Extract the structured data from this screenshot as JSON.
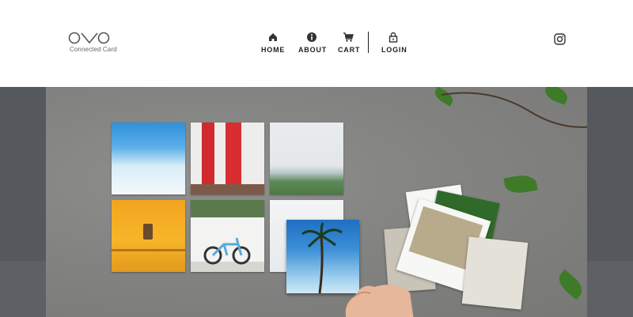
{
  "brand": {
    "logo_text": "OVO",
    "tagline": "Connected Card"
  },
  "nav": {
    "items": [
      {
        "label": "HOME",
        "icon": "home-icon"
      },
      {
        "label": "ABOUT",
        "icon": "info-icon"
      },
      {
        "label": "CART",
        "icon": "cart-icon"
      },
      {
        "label": "LOGIN",
        "icon": "lock-icon"
      }
    ]
  },
  "social": {
    "icon": "instagram-icon"
  },
  "hero": {
    "description": "Square photo prints on a concrete surface",
    "photos": [
      "blue-sky",
      "red-doors",
      "coastline",
      "yellow-wall",
      "bicycle",
      "white-wall",
      "palm-tree"
    ]
  },
  "colors": {
    "header_bg": "#ffffff",
    "nav_text": "#222222",
    "band": "#55585c"
  }
}
